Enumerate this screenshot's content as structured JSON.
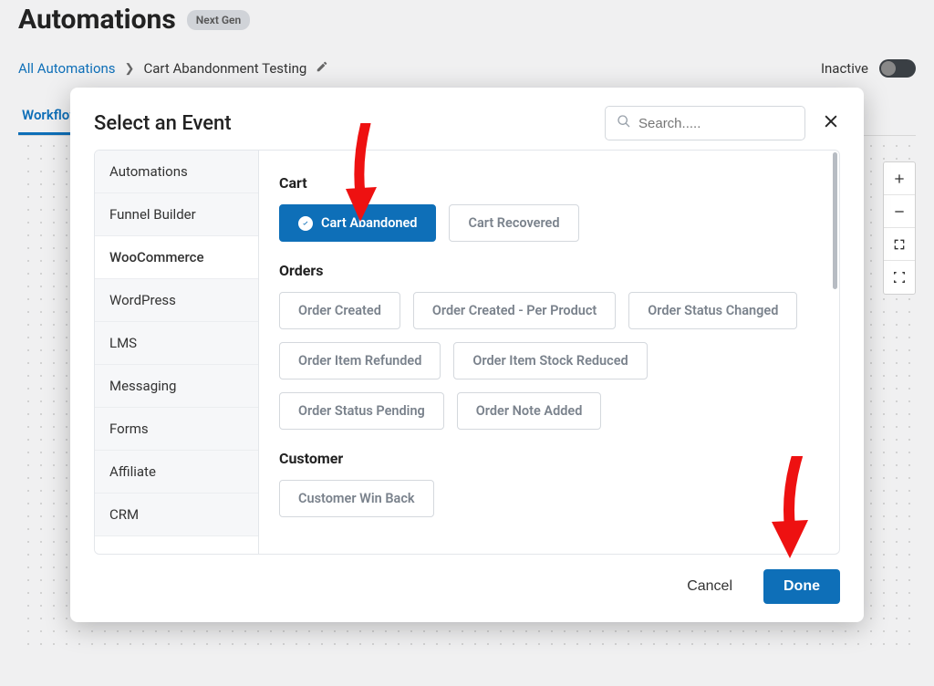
{
  "page": {
    "title": "Automations",
    "badge": "Next Gen"
  },
  "breadcrumbs": {
    "root": "All Automations",
    "current": "Cart Abandonment Testing"
  },
  "status": {
    "label": "Inactive"
  },
  "tabs": {
    "workflow": "Workflow"
  },
  "modal": {
    "title": "Select an Event",
    "search_placeholder": "Search.....",
    "footer": {
      "cancel": "Cancel",
      "done": "Done"
    }
  },
  "sidebar": {
    "items": [
      "Automations",
      "Funnel Builder",
      "WooCommerce",
      "WordPress",
      "LMS",
      "Messaging",
      "Forms",
      "Affiliate",
      "CRM"
    ]
  },
  "events": {
    "cart": {
      "title": "Cart",
      "items": [
        "Cart Abandoned",
        "Cart Recovered"
      ]
    },
    "orders": {
      "title": "Orders",
      "items": [
        "Order Created",
        "Order Created - Per Product",
        "Order Status Changed",
        "Order Item Refunded",
        "Order Item Stock Reduced",
        "Order Status Pending",
        "Order Note Added"
      ]
    },
    "customer": {
      "title": "Customer",
      "items": [
        "Customer Win Back"
      ]
    }
  }
}
